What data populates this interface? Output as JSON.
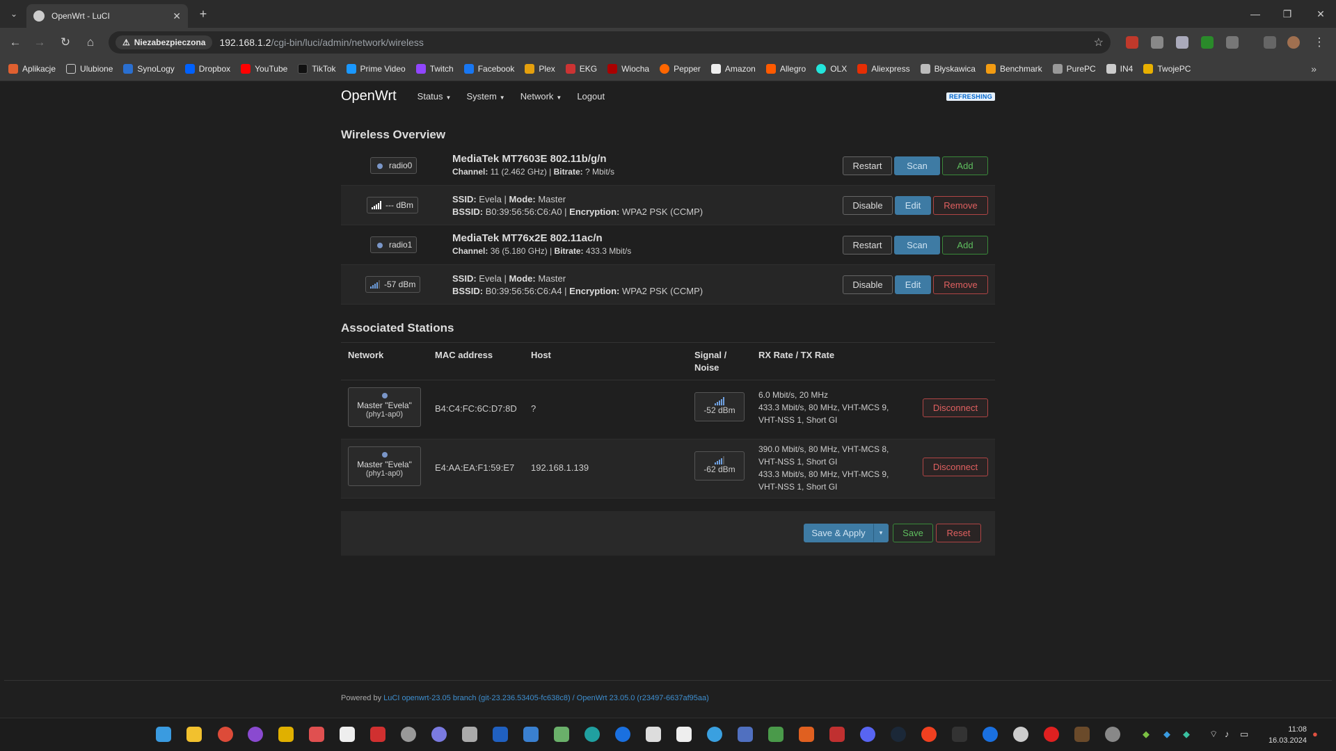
{
  "browser": {
    "tab_title": "OpenWrt - LuCI",
    "insecure_label": "Niezabezpieczona",
    "url_host": "192.168.1.2",
    "url_path": "/cgi-bin/luci/admin/network/wireless",
    "bookmarks": [
      "Aplikacje",
      "Ulubione",
      "SynoLogy",
      "Dropbox",
      "YouTube",
      "TikTok",
      "Prime Video",
      "Twitch",
      "Facebook",
      "Plex",
      "EKG",
      "Wiocha",
      "Pepper",
      "Amazon",
      "Allegro",
      "OLX",
      "Aliexpress",
      "Błyskawica",
      "Benchmark",
      "PurePC",
      "IN4",
      "TwojePC"
    ]
  },
  "header": {
    "brand": "OpenWrt",
    "menu": [
      "Status",
      "System",
      "Network",
      "Logout"
    ],
    "refreshing": "REFRESHING"
  },
  "wireless": {
    "title": "Wireless Overview",
    "radios": [
      {
        "name": "radio0",
        "model": "MediaTek MT7603E 802.11b/g/n",
        "channel_label": "Channel:",
        "channel": "11 (2.462 GHz)",
        "bitrate_label": "Bitrate:",
        "bitrate": "? Mbit/s",
        "buttons": [
          "Restart",
          "Scan",
          "Add"
        ],
        "net": {
          "signal": "--- dBm",
          "ssid_label": "SSID:",
          "ssid": "Evela",
          "mode_label": "Mode:",
          "mode": "Master",
          "bssid_label": "BSSID:",
          "bssid": "B0:39:56:56:C6:A0",
          "enc_label": "Encryption:",
          "enc": "WPA2 PSK (CCMP)",
          "buttons": [
            "Disable",
            "Edit",
            "Remove"
          ]
        }
      },
      {
        "name": "radio1",
        "model": "MediaTek MT76x2E 802.11ac/n",
        "channel_label": "Channel:",
        "channel": "36 (5.180 GHz)",
        "bitrate_label": "Bitrate:",
        "bitrate": "433.3 Mbit/s",
        "buttons": [
          "Restart",
          "Scan",
          "Add"
        ],
        "net": {
          "signal": "-57 dBm",
          "ssid_label": "SSID:",
          "ssid": "Evela",
          "mode_label": "Mode:",
          "mode": "Master",
          "bssid_label": "BSSID:",
          "bssid": "B0:39:56:56:C6:A4",
          "enc_label": "Encryption:",
          "enc": "WPA2 PSK (CCMP)",
          "buttons": [
            "Disable",
            "Edit",
            "Remove"
          ]
        }
      }
    ]
  },
  "stations": {
    "title": "Associated Stations",
    "columns": [
      "Network",
      "MAC address",
      "Host",
      "Signal /",
      "Noise",
      "RX Rate / TX Rate"
    ],
    "rows": [
      {
        "net_l1": "Master \"Evela\"",
        "net_l2": "(phy1-ap0)",
        "mac": "B4:C4:FC:6C:D7:8D",
        "host": "?",
        "signal": "-52 dBm",
        "rates": [
          "6.0 Mbit/s, 20 MHz",
          "433.3 Mbit/s, 80 MHz, VHT-MCS 9,",
          "VHT-NSS 1, Short GI"
        ],
        "action": "Disconnect"
      },
      {
        "net_l1": "Master \"Evela\"",
        "net_l2": "(phy1-ap0)",
        "mac": "E4:AA:EA:F1:59:E7",
        "host": "192.168.1.139",
        "signal": "-62 dBm",
        "rates": [
          "390.0 Mbit/s, 80 MHz, VHT-MCS 8,",
          "VHT-NSS 1, Short GI",
          "433.3 Mbit/s, 80 MHz, VHT-MCS 9,",
          "VHT-NSS 1, Short GI"
        ],
        "action": "Disconnect"
      }
    ]
  },
  "actions": {
    "save_apply": "Save & Apply",
    "save": "Save",
    "reset": "Reset"
  },
  "footer": {
    "powered_by": "Powered by",
    "luci": "LuCI openwrt-23.05 branch (git-23.236.53405-fc638c8)",
    "sep": "/",
    "openwrt": "OpenWrt 23.05.0 (r23497-6637af95aa)"
  },
  "taskbar": {
    "time": "11:08",
    "date": "16.03.2024"
  },
  "colors": {
    "accent_blue": "#3e7ba4",
    "green": "#5fbf5f",
    "red": "#e06060"
  }
}
